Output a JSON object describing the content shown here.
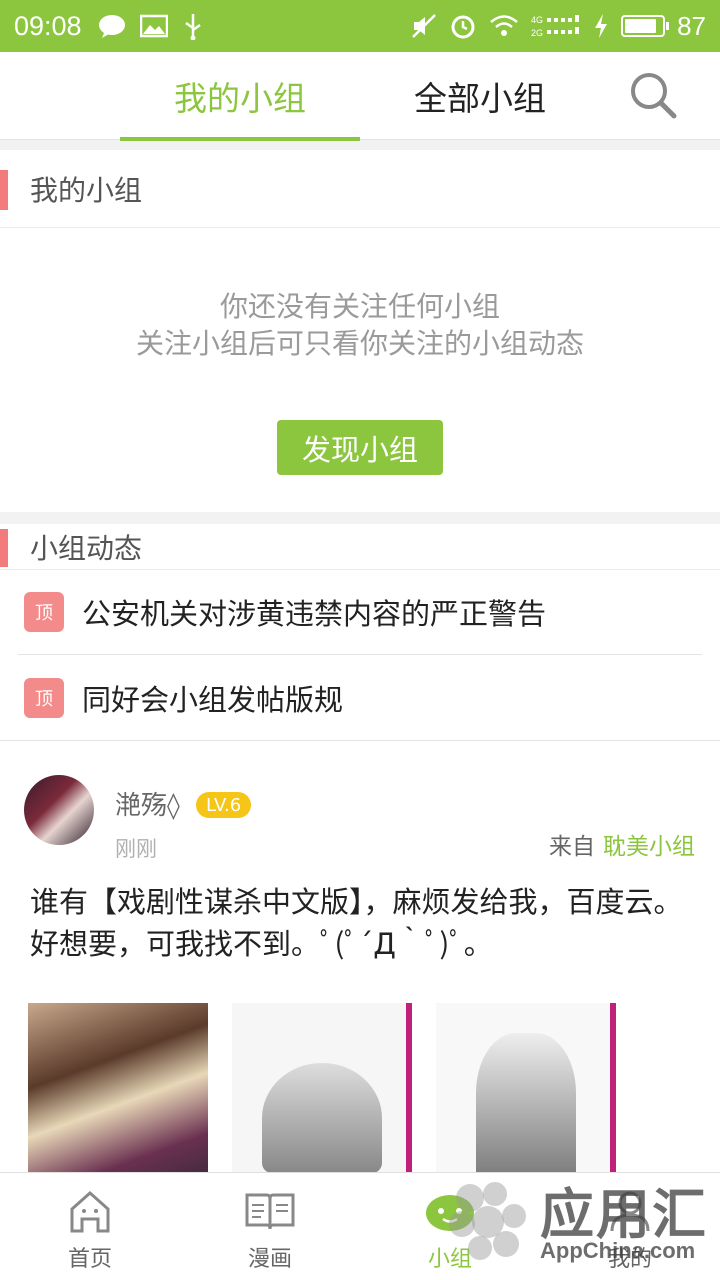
{
  "status_bar": {
    "time": "09:08",
    "battery_percent": "87",
    "battery_level": 0.87,
    "network": "4G 2G",
    "accent_color": "#8cc63f"
  },
  "top_tabs": {
    "my_groups": "我的小组",
    "all_groups": "全部小组",
    "search_icon": "search-icon"
  },
  "my_groups_section": {
    "title": "我的小组",
    "empty_line1": "你还没有关注任何小组",
    "empty_line2": "关注小组后可只看你关注的小组动态",
    "discover_button": "发现小组"
  },
  "feed_section": {
    "title": "小组动态",
    "pin_tag": "顶",
    "pinned": [
      {
        "title": "公安机关对涉黄违禁内容的严正警告"
      },
      {
        "title": "同好会小组发帖版规"
      }
    ]
  },
  "post": {
    "username": "滟殇◊",
    "level": "LV.6",
    "time": "刚刚",
    "from_label": "来自",
    "group": "耽美小组",
    "body": "谁有【戏剧性谋杀中文版】，麻烦发给我，百度云。好想要，可我找不到。ﾟ(ﾟ´Д｀ﾟ)ﾟ。"
  },
  "bottom_nav": [
    {
      "label": "首页",
      "icon": "home-icon"
    },
    {
      "label": "漫画",
      "icon": "book-icon"
    },
    {
      "label": "小组",
      "icon": "group-icon"
    },
    {
      "label": "我的",
      "icon": "user-icon"
    }
  ],
  "watermark": {
    "text": "应用汇",
    "sub": "AppChina.com"
  }
}
